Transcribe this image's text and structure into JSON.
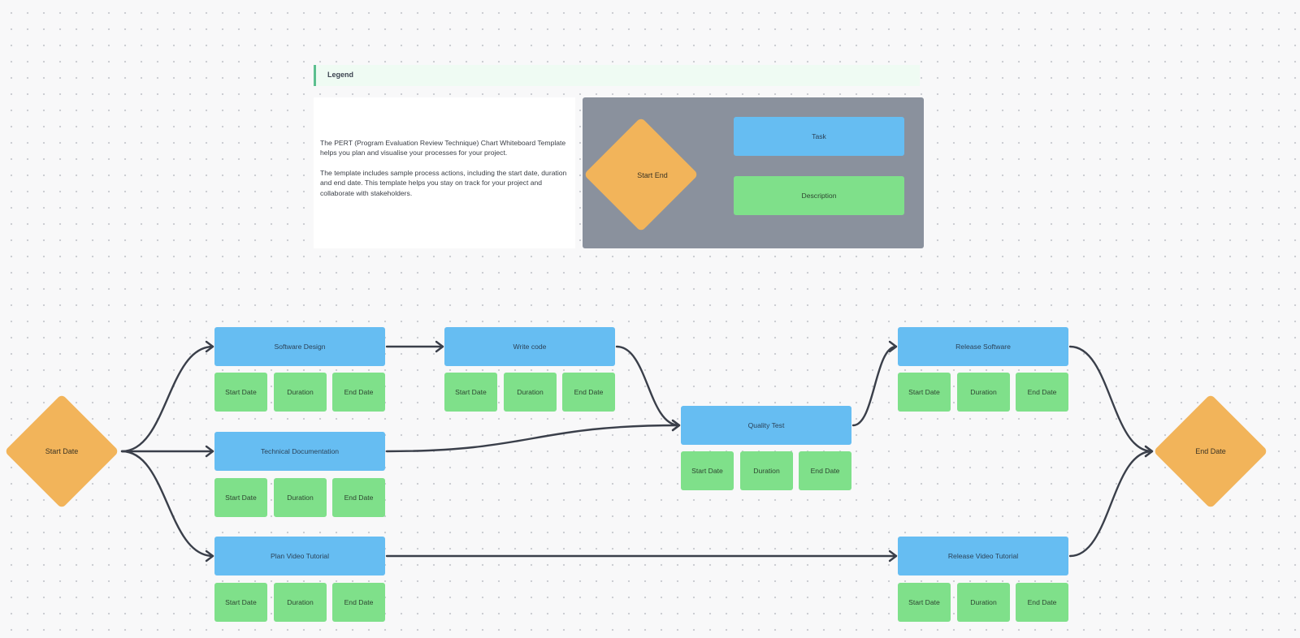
{
  "legend": {
    "header": "Legend",
    "description": [
      "The PERT (Program Evaluation Review Technique) Chart Whiteboard Template helps you plan and visualise your processes for your project.",
      "The template includes sample process actions, including the start date, duration and end date. This template helps you stay on track for your project and collaborate with stakeholders."
    ],
    "shapes": {
      "start_end": "Start End",
      "task": "Task",
      "description": "Description"
    }
  },
  "colors": {
    "start_end": "#f2b45a",
    "task": "#66bdf2",
    "description": "#7fe08a",
    "legend_panel": "#8a919d",
    "connector": "#3a3f4a"
  },
  "diagram": {
    "start": "Start Date",
    "end": "End Date",
    "tasks": [
      {
        "id": "software-design",
        "label": "Software Design",
        "subs": [
          "Start Date",
          "Duration",
          "End Date"
        ]
      },
      {
        "id": "technical-documentation",
        "label": "Technical Documentation",
        "subs": [
          "Start Date",
          "Duration",
          "End Date"
        ]
      },
      {
        "id": "plan-video-tutorial",
        "label": "Plan Video Tutorial",
        "subs": [
          "Start Date",
          "Duration",
          "End Date"
        ]
      },
      {
        "id": "write-code",
        "label": "Write code",
        "subs": [
          "Start Date",
          "Duration",
          "End Date"
        ]
      },
      {
        "id": "quality-test",
        "label": "Quality Test",
        "subs": [
          "Start Date",
          "Duration",
          "End Date"
        ]
      },
      {
        "id": "release-software",
        "label": "Release Software",
        "subs": [
          "Start Date",
          "Duration",
          "End Date"
        ]
      },
      {
        "id": "release-video-tutorial",
        "label": "Release Video Tutorial",
        "subs": [
          "Start Date",
          "Duration",
          "End Date"
        ]
      }
    ],
    "connections": [
      [
        "start",
        "software-design"
      ],
      [
        "start",
        "technical-documentation"
      ],
      [
        "start",
        "plan-video-tutorial"
      ],
      [
        "software-design",
        "write-code"
      ],
      [
        "write-code",
        "quality-test"
      ],
      [
        "technical-documentation",
        "quality-test"
      ],
      [
        "quality-test",
        "release-software"
      ],
      [
        "plan-video-tutorial",
        "release-video-tutorial"
      ],
      [
        "release-software",
        "end"
      ],
      [
        "release-video-tutorial",
        "end"
      ]
    ]
  }
}
